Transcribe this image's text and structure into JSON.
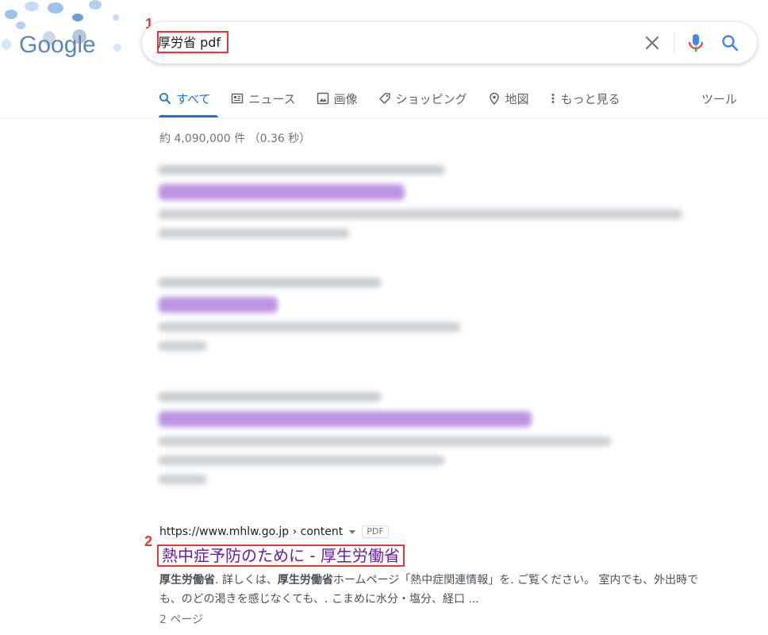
{
  "logo": {
    "text": "Google"
  },
  "search": {
    "query": "厚労省 pdf",
    "step_marker": "1"
  },
  "tabs": [
    {
      "label": "すべて",
      "icon": "search-icon",
      "active": true
    },
    {
      "label": "ニュース",
      "icon": "news-icon",
      "active": false
    },
    {
      "label": "画像",
      "icon": "image-icon",
      "active": false
    },
    {
      "label": "ショッピング",
      "icon": "tag-icon",
      "active": false
    },
    {
      "label": "地図",
      "icon": "map-pin-icon",
      "active": false
    },
    {
      "label": "もっと見る",
      "icon": "more-vert-icon",
      "active": false
    }
  ],
  "tools_label": "ツール",
  "stats": "約 4,090,000 件 （0.36 秒）",
  "result": {
    "step_marker": "2",
    "cite": "https://www.mhlw.go.jp › content",
    "badge": "PDF",
    "title": "熱中症予防のために - 厚生労働省",
    "snippet_b1": "厚生労働省",
    "snippet_t1": ". 詳しくは、",
    "snippet_b2": "厚生労働省",
    "snippet_t2": "ホームページ「熱中症関連情報」を. ご覧ください。 室内でも、外出時でも、のどの渇きを感じなくても、. こまめに水分・塩分、経口 ...",
    "pages": "2 ページ"
  },
  "colors": {
    "link": "#681da8",
    "accent": "#1a73e8",
    "highlight": "#e53935"
  }
}
